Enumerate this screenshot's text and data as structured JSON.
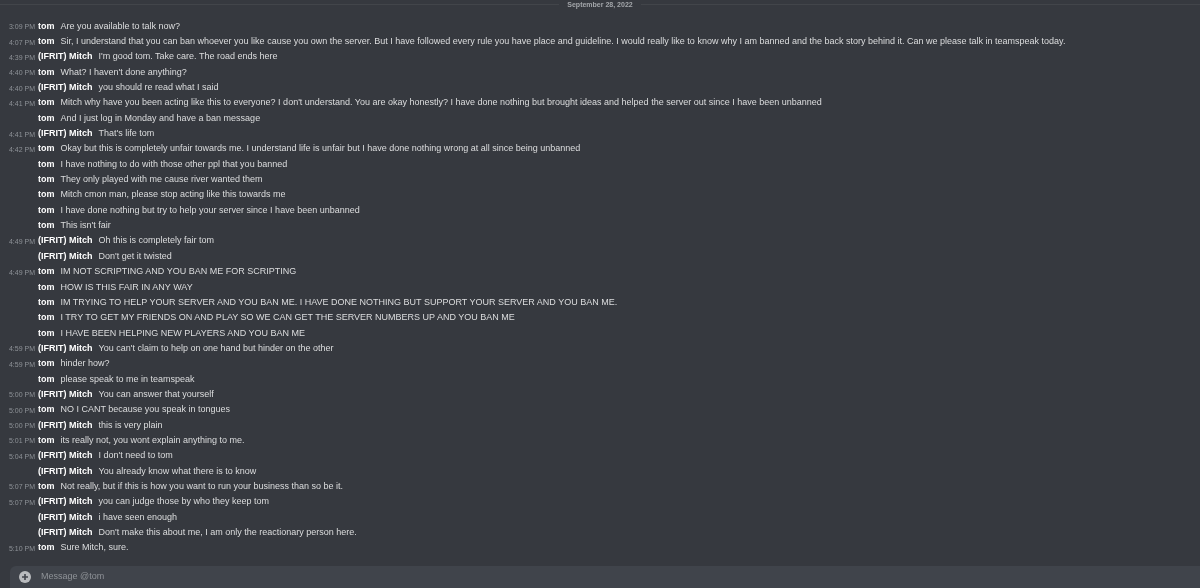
{
  "date_divider": "September 28, 2022",
  "messages": [
    {
      "time": "3:09 PM",
      "author": "tom",
      "text": "Are you available to talk now?"
    },
    {
      "time": "4:07 PM",
      "author": "tom",
      "text": "Sir, I understand that you can ban whoever you like cause you own the server. But I have followed every rule you have place and guideline. I would really like to know why I am banned and the back story behind it. Can we please talk in teamspeak today."
    },
    {
      "time": "4:39 PM",
      "author": "(IFRIT) Mitch",
      "text": "I'm good tom. Take care. The road ends here"
    },
    {
      "time": "4:40 PM",
      "author": "tom",
      "text": "What? I haven't done anything?"
    },
    {
      "time": "4:40 PM",
      "author": "(IFRIT) Mitch",
      "text": "you should re read what I said"
    },
    {
      "time": "4:41 PM",
      "author": "tom",
      "text": "Mitch why have you been acting like this to everyone? I don't understand. You are okay honestly? I have done nothing but brought ideas and helped the server out since I have been unbanned"
    },
    {
      "author": "tom",
      "text": "And I just log in Monday and have a ban message"
    },
    {
      "time": "4:41 PM",
      "author": "(IFRIT) Mitch",
      "text": "That's life tom"
    },
    {
      "time": "4:42 PM",
      "author": "tom",
      "text": "Okay but this is completely unfair towards me. I understand life is unfair but I have done nothing wrong at all since being unbanned"
    },
    {
      "author": "tom",
      "text": "I have nothing to do with those other ppl that you banned"
    },
    {
      "author": "tom",
      "text": "They only played with me cause river wanted them"
    },
    {
      "author": "tom",
      "text": "Mitch cmon man, please stop acting like this towards me"
    },
    {
      "author": "tom",
      "text": "I have done nothing but try to help your server since I have been unbanned"
    },
    {
      "author": "tom",
      "text": "This isn't fair"
    },
    {
      "time": "4:49 PM",
      "author": "(IFRIT) Mitch",
      "text": "Oh this is completely fair tom"
    },
    {
      "author": "(IFRIT) Mitch",
      "text": "Don't get it twisted"
    },
    {
      "time": "4:49 PM",
      "author": "tom",
      "text": "IM NOT SCRIPTING AND YOU BAN ME FOR SCRIPTING"
    },
    {
      "author": "tom",
      "text": "HOW IS THIS FAIR IN ANY WAY"
    },
    {
      "author": "tom",
      "text": "IM TRYING TO HELP YOUR SERVER AND YOU BAN ME. I HAVE DONE NOTHING BUT SUPPORT YOUR SERVER AND YOU BAN ME."
    },
    {
      "author": "tom",
      "text": "I TRY TO GET MY FRIENDS ON AND PLAY SO WE CAN GET THE SERVER NUMBERS UP AND YOU BAN ME"
    },
    {
      "author": "tom",
      "text": "I HAVE BEEN HELPING NEW PLAYERS AND YOU BAN ME"
    },
    {
      "time": "4:59 PM",
      "author": "(IFRIT) Mitch",
      "text": "You can't claim to help on one hand but hinder on the other"
    },
    {
      "time": "4:59 PM",
      "author": "tom",
      "text": "hinder how?"
    },
    {
      "author": "tom",
      "text": "please speak to me in teamspeak"
    },
    {
      "time": "5:00 PM",
      "author": "(IFRIT) Mitch",
      "text": "You can answer that yourself"
    },
    {
      "time": "5:00 PM",
      "author": "tom",
      "text": "NO I CANT because you speak in tongues"
    },
    {
      "time": "5:00 PM",
      "author": "(IFRIT) Mitch",
      "text": "this is very plain"
    },
    {
      "time": "5:01 PM",
      "author": "tom",
      "text": "its really not, you wont explain anything to me."
    },
    {
      "time": "5:04 PM",
      "author": "(IFRIT) Mitch",
      "text": "I don't need to tom"
    },
    {
      "author": "(IFRIT) Mitch",
      "text": "You already know what there is to know"
    },
    {
      "time": "5:07 PM",
      "author": "tom",
      "text": "Not really, but if this is how you want to run your business than so be it."
    },
    {
      "time": "5:07 PM",
      "author": "(IFRIT) Mitch",
      "text": "you can judge those by who they keep tom"
    },
    {
      "author": "(IFRIT) Mitch",
      "text": "i have seen enough"
    },
    {
      "author": "(IFRIT) Mitch",
      "text": "Don't make this about me, I am only the reactionary person here."
    },
    {
      "time": "5:10 PM",
      "author": "tom",
      "text": "Sure Mitch, sure."
    }
  ],
  "composer": {
    "placeholder": "Message @tom"
  }
}
